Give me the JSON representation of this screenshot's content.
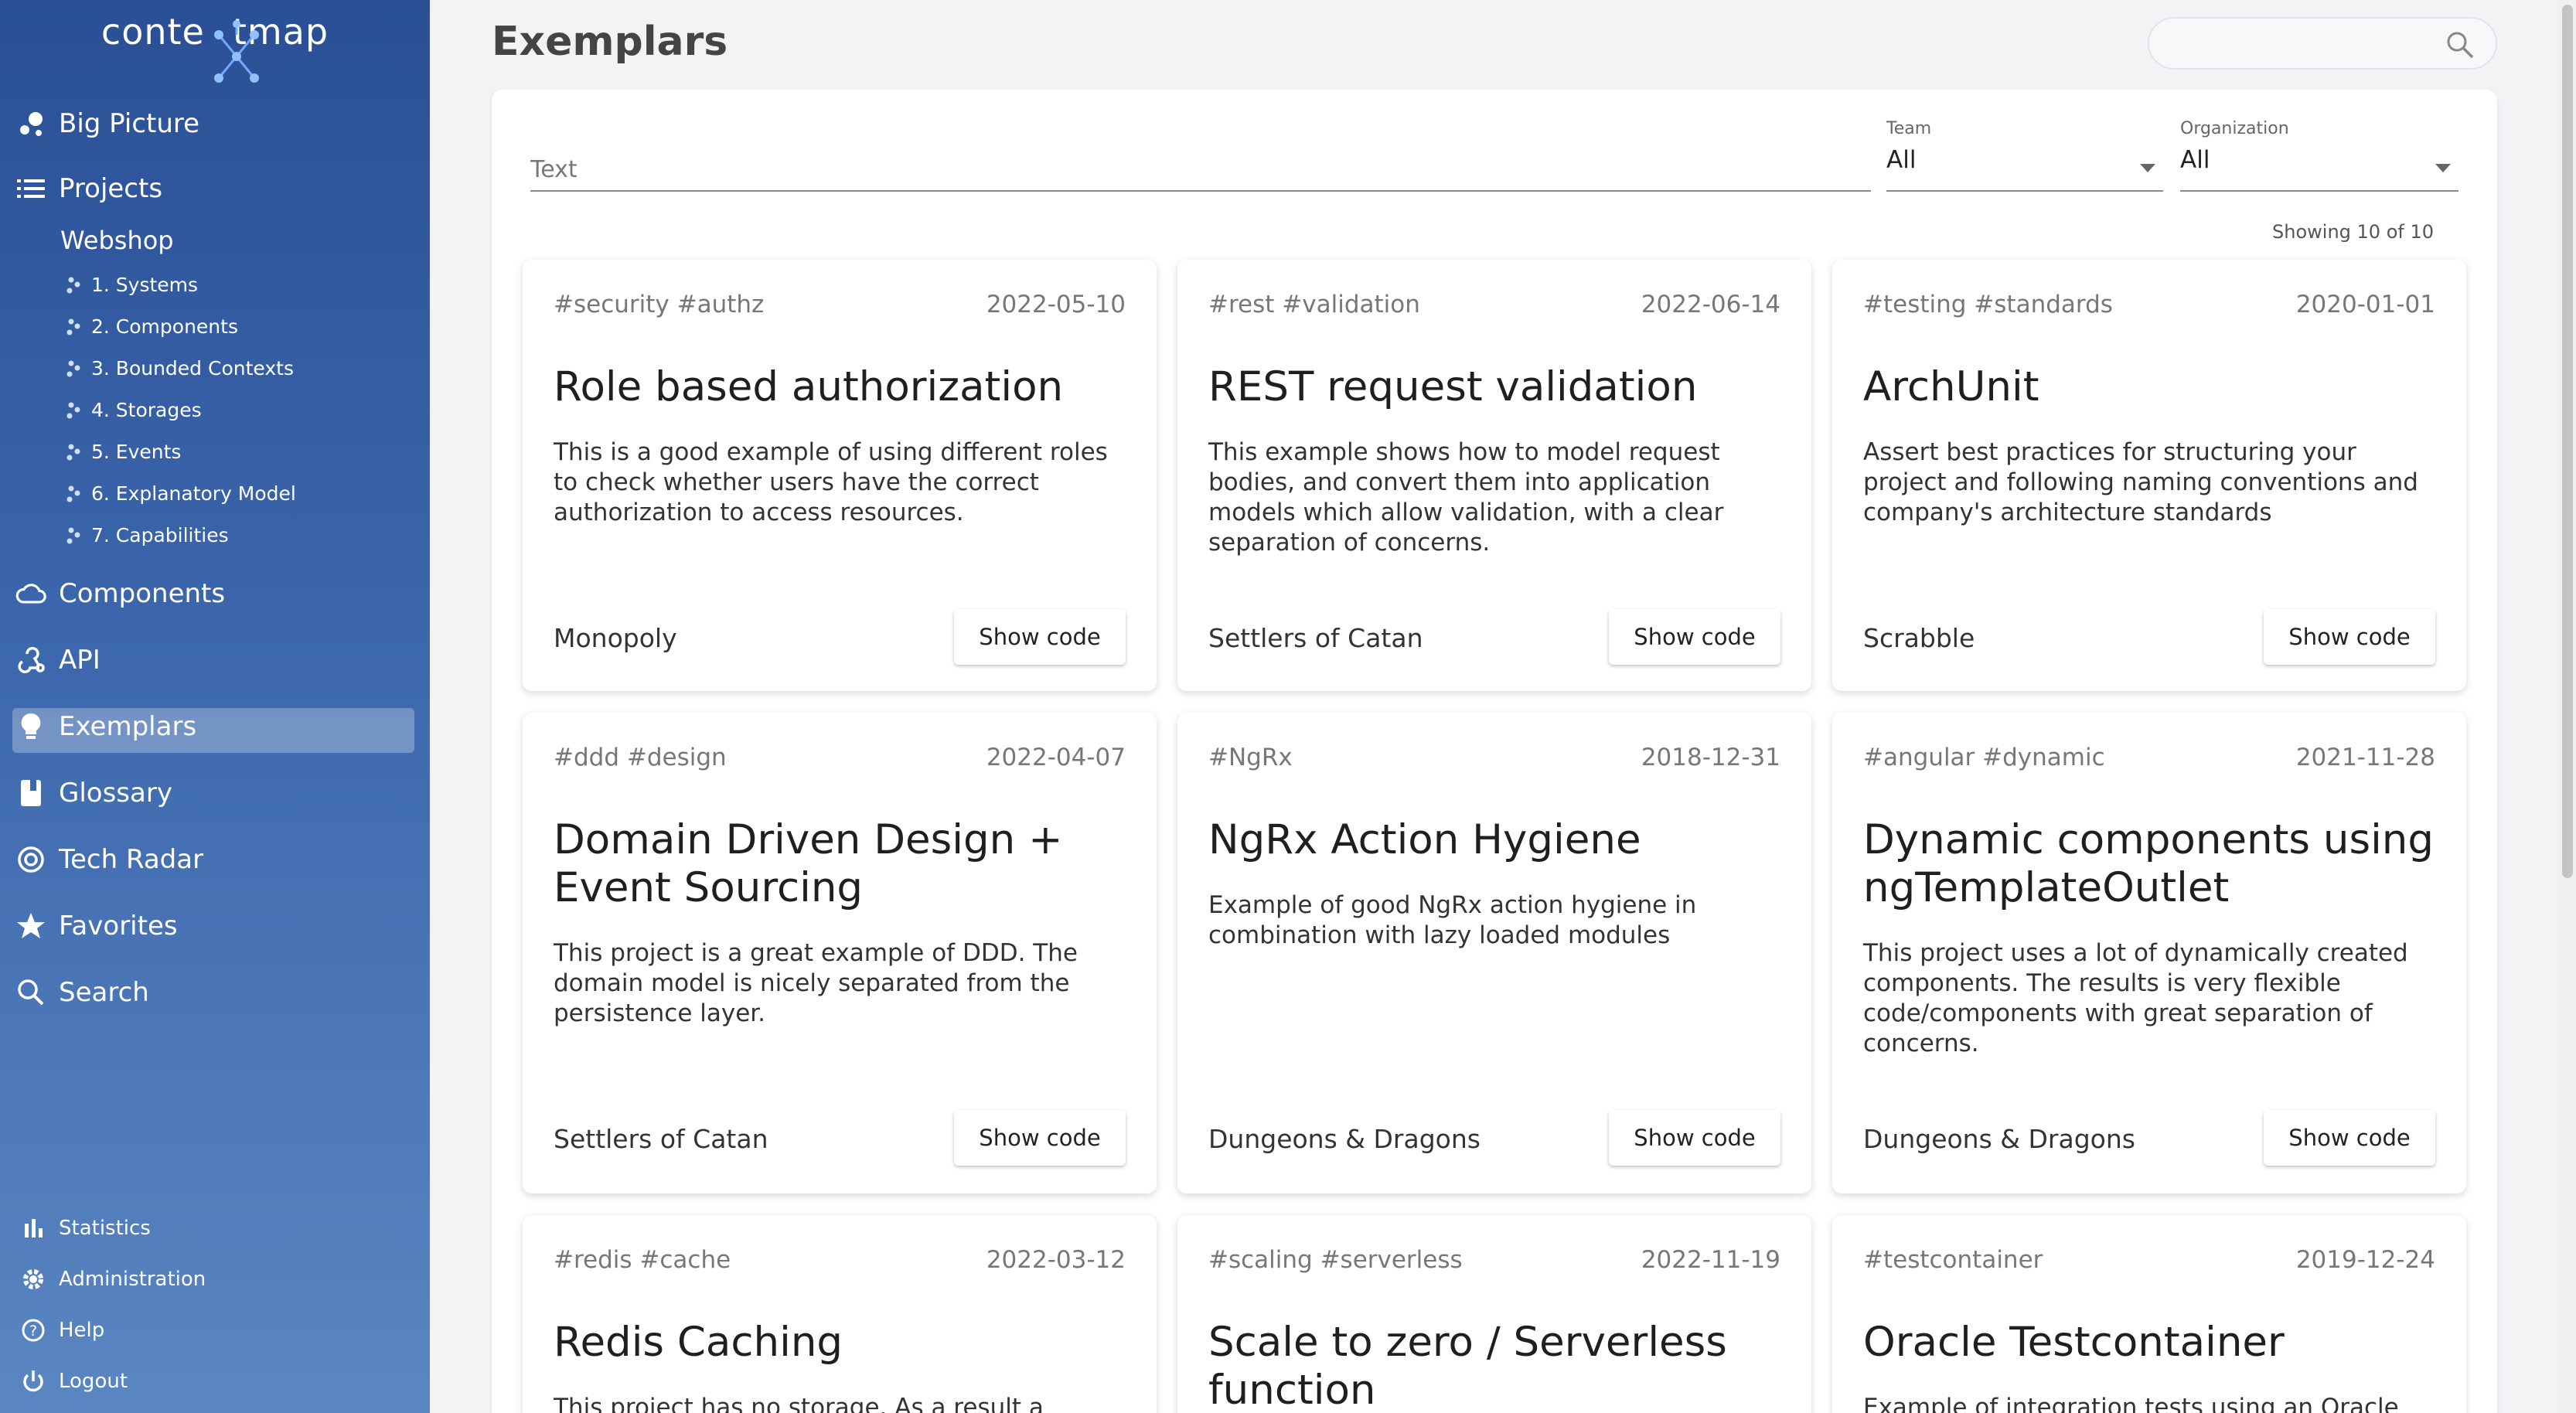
{
  "app": {
    "logo_text_a": "conte",
    "logo_text_b": "tmap"
  },
  "sidebar": {
    "items": [
      {
        "label": "Big Picture",
        "icon": "bubbles-icon"
      },
      {
        "label": "Projects",
        "icon": "list-icon"
      },
      {
        "label": "Components",
        "icon": "cloud-icon"
      },
      {
        "label": "API",
        "icon": "webhook-icon"
      },
      {
        "label": "Exemplars",
        "icon": "lightbulb-icon"
      },
      {
        "label": "Glossary",
        "icon": "book-icon"
      },
      {
        "label": "Tech Radar",
        "icon": "radar-icon"
      },
      {
        "label": "Favorites",
        "icon": "star-icon"
      },
      {
        "label": "Search",
        "icon": "search-icon"
      }
    ],
    "project": "Webshop",
    "project_views": [
      "1. Systems",
      "2. Components",
      "3. Bounded Contexts",
      "4. Storages",
      "5. Events",
      "6. Explanatory Model",
      "7. Capabilities"
    ],
    "bottom": [
      {
        "label": "Statistics",
        "icon": "bar-chart-icon"
      },
      {
        "label": "Administration",
        "icon": "gear-icon"
      },
      {
        "label": "Help",
        "icon": "help-icon"
      },
      {
        "label": "Logout",
        "icon": "power-icon"
      }
    ],
    "active": "Exemplars"
  },
  "page": {
    "title": "Exemplars"
  },
  "filters": {
    "text_placeholder": "Text",
    "team_label": "Team",
    "team_value": "All",
    "org_label": "Organization",
    "org_value": "All",
    "showing": "Showing 10 of 10"
  },
  "cards": [
    {
      "tags": "#security #authz",
      "date": "2022-05-10",
      "title": "Role based authorization",
      "desc": "This is a good example of using different roles to check whether users have the correct authorization to access resources.",
      "team": "Monopoly",
      "button": "Show code"
    },
    {
      "tags": "#rest #validation",
      "date": "2022-06-14",
      "title": "REST request validation",
      "desc": "This example shows how to model request bodies, and convert them into application models which allow validation, with a clear separation of concerns.",
      "team": "Settlers of Catan",
      "button": "Show code"
    },
    {
      "tags": "#testing #standards",
      "date": "2020-01-01",
      "title": "ArchUnit",
      "desc": "Assert best practices for structuring your project and following naming conventions and company's architecture standards",
      "team": "Scrabble",
      "button": "Show code"
    },
    {
      "tags": "#ddd #design",
      "date": "2022-04-07",
      "title": "Domain Driven Design + Event Sourcing",
      "desc": "This project is a great example of DDD. The domain model is nicely separated from the persistence layer.",
      "team": "Settlers of Catan",
      "button": "Show code"
    },
    {
      "tags": "#NgRx",
      "date": "2018-12-31",
      "title": "NgRx Action Hygiene",
      "desc": "Example of good NgRx action hygiene in combination with lazy loaded modules",
      "team": "Dungeons & Dragons",
      "button": "Show code"
    },
    {
      "tags": "#angular #dynamic",
      "date": "2021-11-28",
      "title": "Dynamic components using ngTemplateOutlet",
      "desc": "This project uses a lot of dynamically created components. The results is very flexible code/components with great separation of concerns.",
      "team": "Dungeons & Dragons",
      "button": "Show code"
    },
    {
      "tags": "#redis #cache",
      "date": "2022-03-12",
      "title": "Redis Caching",
      "desc": "This project has no storage. As a result a",
      "team": "",
      "button": ""
    },
    {
      "tags": "#scaling #serverless",
      "date": "2022-11-19",
      "title": "Scale to zero / Serverless function",
      "desc": "",
      "team": "",
      "button": ""
    },
    {
      "tags": "#testcontainer",
      "date": "2019-12-24",
      "title": "Oracle Testcontainer",
      "desc": "Example of integration tests using an Oracle",
      "team": "",
      "button": ""
    }
  ]
}
